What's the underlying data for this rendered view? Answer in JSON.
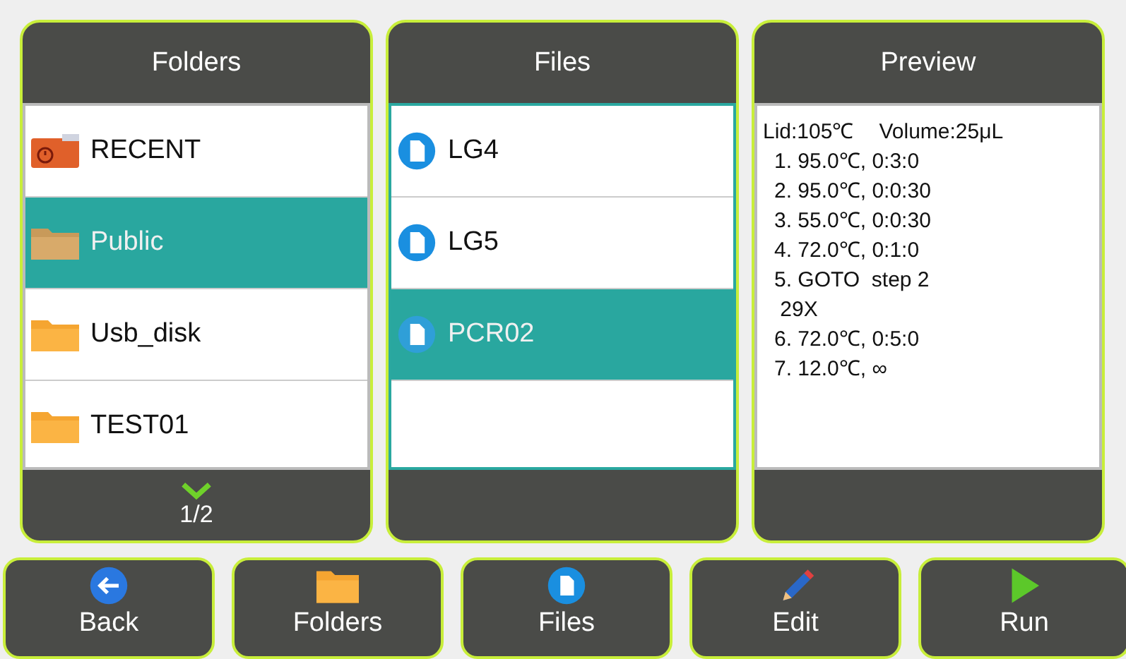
{
  "panels": {
    "folders": {
      "title": "Folders",
      "items": [
        {
          "name": "RECENT",
          "kind": "recent",
          "selected": false
        },
        {
          "name": "Public",
          "kind": "folder",
          "selected": true
        },
        {
          "name": "Usb_disk",
          "kind": "folder",
          "selected": false
        },
        {
          "name": "TEST01",
          "kind": "folder",
          "selected": false
        }
      ],
      "page": "1/2"
    },
    "files": {
      "title": "Files",
      "items": [
        {
          "name": "LG4",
          "selected": false
        },
        {
          "name": "LG5",
          "selected": false
        },
        {
          "name": "PCR02",
          "selected": true
        }
      ]
    },
    "preview": {
      "title": "Preview",
      "lid": "Lid:105℃",
      "volume": "Volume:25μL",
      "lines": [
        "1. 95.0℃, 0:3:0",
        "2. 95.0℃, 0:0:30",
        "3. 55.0℃, 0:0:30",
        "4. 72.0℃, 0:1:0",
        "5. GOTO  step 2",
        " 29X",
        "6. 72.0℃, 0:5:0",
        "7. 12.0℃, ∞"
      ]
    }
  },
  "toolbar": [
    {
      "label": "Back",
      "kind": "back"
    },
    {
      "label": "Folders",
      "kind": "folder"
    },
    {
      "label": "Files",
      "kind": "file"
    },
    {
      "label": "Edit",
      "kind": "edit"
    },
    {
      "label": "Run",
      "kind": "run"
    }
  ]
}
